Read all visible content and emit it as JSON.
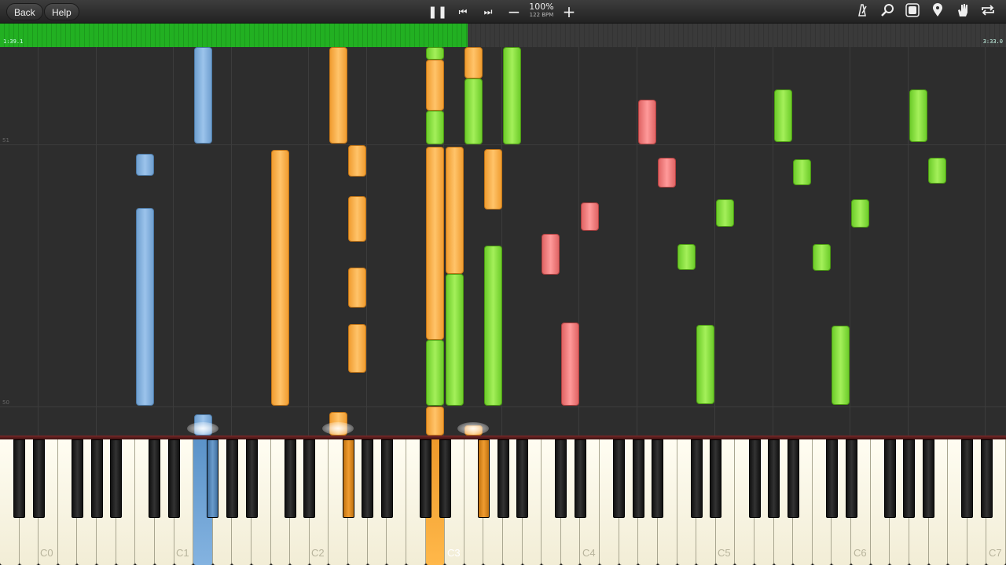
{
  "toolbar": {
    "back_label": "Back",
    "help_label": "Help",
    "speed_percent": "100%",
    "tempo": "122 BPM",
    "icons": [
      "pause-icon",
      "skip-back-icon",
      "skip-forward-icon",
      "minus-icon",
      "plus-icon",
      "metronome-icon",
      "magnifier-icon",
      "note-labels-icon",
      "location-pin-icon",
      "hand-icon",
      "loop-icon"
    ]
  },
  "timeline": {
    "current_time": "1:39.1",
    "total_time": "3:33.0",
    "progress": 0.465
  },
  "measures": {
    "upper": "51",
    "lower": "50"
  },
  "keyboard": {
    "octave_labels": [
      "C0",
      "C1",
      "C2",
      "C3",
      "C4",
      "C5",
      "C6",
      "C7"
    ]
  },
  "colors": {
    "blue_track": "#8ab4e0",
    "orange_track": "#ffb347",
    "green_track": "#8be04a",
    "red_track": "#f07a7a",
    "progress": "#22b022"
  }
}
